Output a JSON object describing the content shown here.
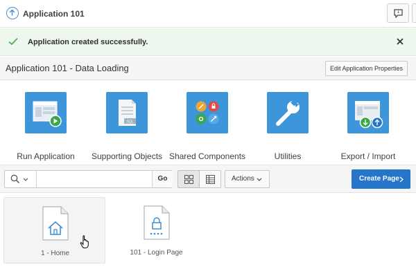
{
  "header": {
    "app_title": "Application 101",
    "up_icon": "arrow-up-circle-icon",
    "feedback_icon": "feedback-icon"
  },
  "alert": {
    "message": "Application created successfully.",
    "status_color": "#4caf50"
  },
  "page": {
    "title": "Application 101 - Data Loading",
    "edit_button": "Edit Application Properties"
  },
  "tiles": [
    {
      "label": "Run Application",
      "icon": "run-application-icon"
    },
    {
      "label": "Supporting Objects",
      "icon": "supporting-objects-icon"
    },
    {
      "label": "Shared Components",
      "icon": "shared-components-icon"
    },
    {
      "label": "Utilities",
      "icon": "wrench-icon"
    },
    {
      "label": "Export / Import",
      "icon": "export-import-icon"
    }
  ],
  "toolbar": {
    "search_value": "",
    "go_label": "Go",
    "actions_label": "Actions",
    "create_page_label": "Create Page"
  },
  "pages": [
    {
      "label": "1 - Home",
      "icon": "home-page-icon"
    },
    {
      "label": "101 - Login Page",
      "icon": "login-page-icon"
    }
  ],
  "colors": {
    "accent": "#3c96d9",
    "primary_button": "#2576c8"
  }
}
